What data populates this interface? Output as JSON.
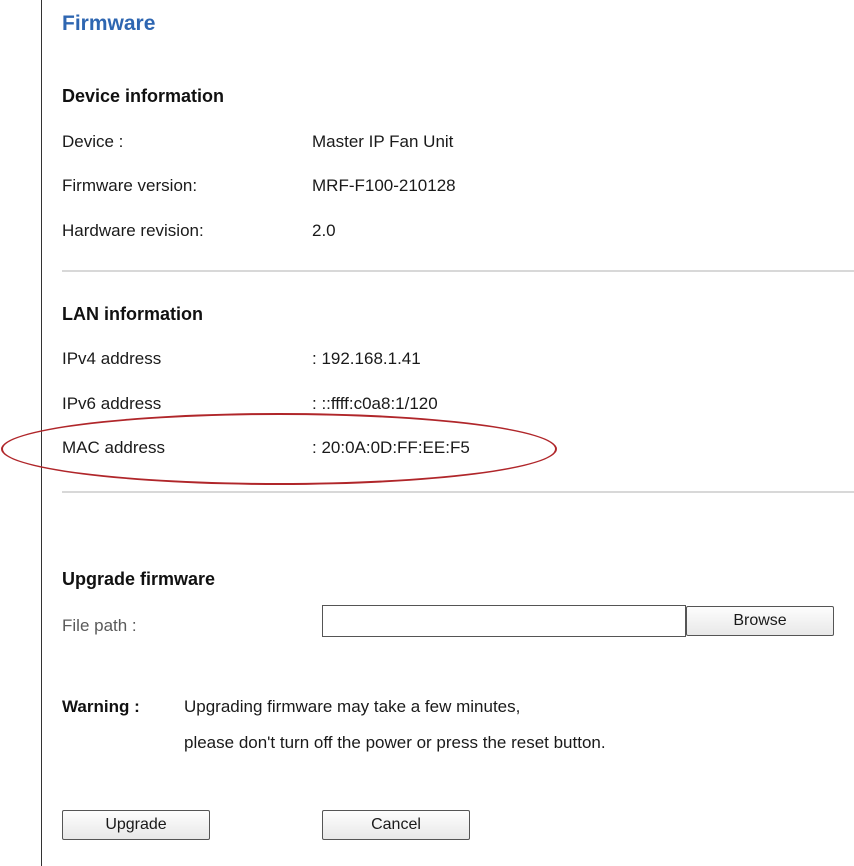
{
  "page": {
    "title": "Firmware"
  },
  "device_info": {
    "heading": "Device information",
    "rows": [
      {
        "label": "Device :",
        "value": "Master IP Fan Unit"
      },
      {
        "label": "Firmware version:",
        "value": "MRF-F100-210128"
      },
      {
        "label": "Hardware revision:",
        "value": "2.0"
      }
    ]
  },
  "lan_info": {
    "heading": "LAN information",
    "rows": [
      {
        "label": "IPv4 address",
        "value": ": 192.168.1.41"
      },
      {
        "label": "IPv6 address",
        "value": ": ::ffff:c0a8:1/120"
      },
      {
        "label": "MAC address",
        "value": ": 20:0A:0D:FF:EE:F5"
      }
    ],
    "highlight_color": "#b0262a"
  },
  "upgrade": {
    "heading": "Upgrade firmware",
    "file_path_label": "File path :",
    "file_path_value": "",
    "browse_label": "Browse"
  },
  "warning": {
    "key": "Warning :",
    "line1": "Upgrading firmware may take a few minutes,",
    "line2": "please don't turn off the power or press the reset button."
  },
  "actions": {
    "upgrade_label": "Upgrade",
    "cancel_label": "Cancel"
  },
  "colors": {
    "title": "#2e66b1",
    "divider": "#d8d8d8"
  }
}
